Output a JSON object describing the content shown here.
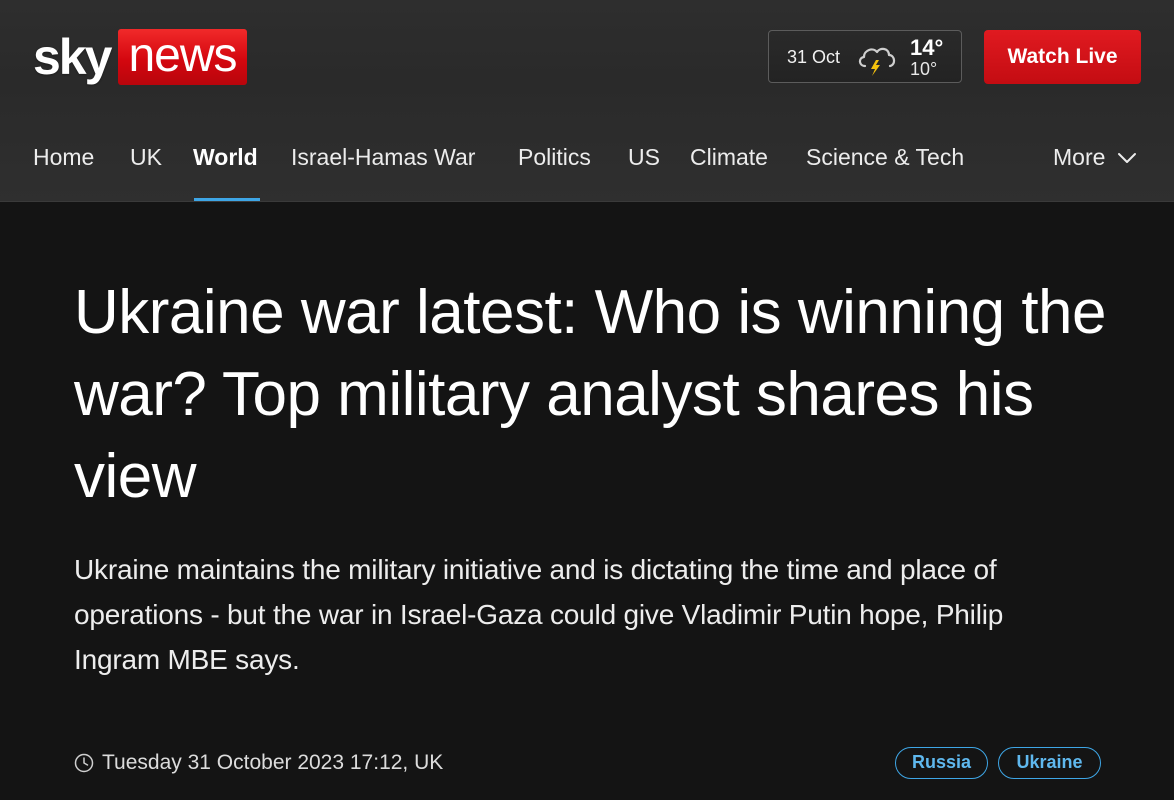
{
  "brand": {
    "sky": "sky",
    "news": "news",
    "news_color": "#d4070f"
  },
  "weather": {
    "date": "31 Oct",
    "high": "14°",
    "low": "10°",
    "icon": "cloud-lightning-icon"
  },
  "header": {
    "watch_live_label": "Watch Live",
    "watch_live_color": "#d20f16"
  },
  "nav": {
    "items": [
      {
        "label": "Home"
      },
      {
        "label": "UK"
      },
      {
        "label": "World",
        "active": true
      },
      {
        "label": "Israel-Hamas War"
      },
      {
        "label": "Politics"
      },
      {
        "label": "US"
      },
      {
        "label": "Climate"
      },
      {
        "label": "Science & Tech"
      }
    ],
    "more_label": "More",
    "active_color": "#3ea6e6"
  },
  "article": {
    "headline": "Ukraine war latest: Who is winning the war? Top military analyst shares his view",
    "standfirst": "Ukraine maintains the military initiative and is dictating the time and place of operations - but the war in Israel-Gaza could give Vladimir Putin hope, Philip Ingram MBE says.",
    "timestamp": "Tuesday 31 October 2023 17:12, UK",
    "tags": [
      {
        "label": "Russia"
      },
      {
        "label": "Ukraine"
      }
    ]
  }
}
